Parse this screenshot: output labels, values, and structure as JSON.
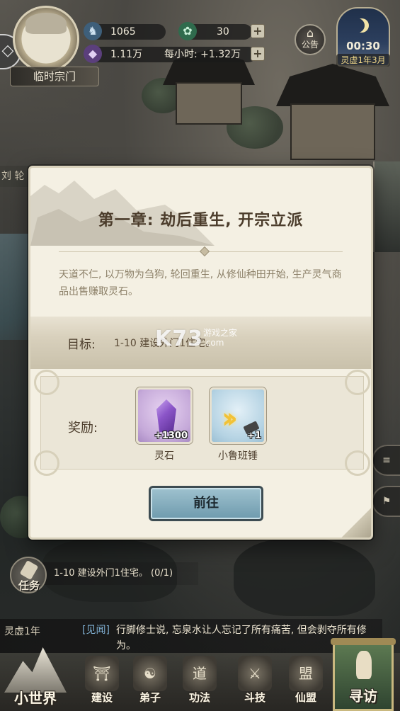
{
  "hud": {
    "avatar_name": "临时宗门",
    "res_a_value": "1065",
    "res_b_value": "30",
    "spirit_stone_value": "1.11万",
    "per_hour_text": "每小时: +1.32万",
    "notice_label": "公告",
    "clock_time": "00:30",
    "clock_date": "灵虚1年3月",
    "side_left_text": "刘  轮",
    "side_right_texts": [
      "",
      ""
    ]
  },
  "modal": {
    "title": "第一章: 劫后重生, 开宗立派",
    "description": "天道不仁, 以万物为刍狗, 轮回重生, 从修仙种田开始, 生产灵气商品出售赚取灵石。",
    "goal_label": "目标:",
    "goal_text": "1-10 建设外门1住宅。",
    "watermark": "K73",
    "watermark_sub_1": "游戏之家",
    "watermark_sub_2": ".com",
    "reward_label": "奖励:",
    "rewards": [
      {
        "name": "灵石",
        "count": "+1300",
        "icon": "spirit-stone-crystal-icon"
      },
      {
        "name": "小鲁班锤",
        "count": "+1",
        "icon": "luban-hammer-icon"
      }
    ],
    "goto_label": "前往"
  },
  "task": {
    "label": "任务",
    "text": "1-10 建设外门1住宅。 (0/1)"
  },
  "news": {
    "date": "灵虚1年",
    "tag": "[见闻]",
    "text": "行脚修士说, 忘泉水让人忘记了所有痛苦, 但会剥夺所有修为。"
  },
  "nav": {
    "world": "小世界",
    "items": [
      {
        "label": "建设",
        "icon": "pavilion-icon",
        "glyph": "⛩"
      },
      {
        "label": "弟子",
        "icon": "disciple-icon",
        "glyph": "☯"
      },
      {
        "label": "功法",
        "icon": "scroll-icon",
        "glyph": "道"
      },
      {
        "label": "斗技",
        "icon": "swords-icon",
        "glyph": "⚔"
      },
      {
        "label": "仙盟",
        "icon": "alliance-icon",
        "glyph": "盟"
      }
    ],
    "visit": "寻访"
  }
}
